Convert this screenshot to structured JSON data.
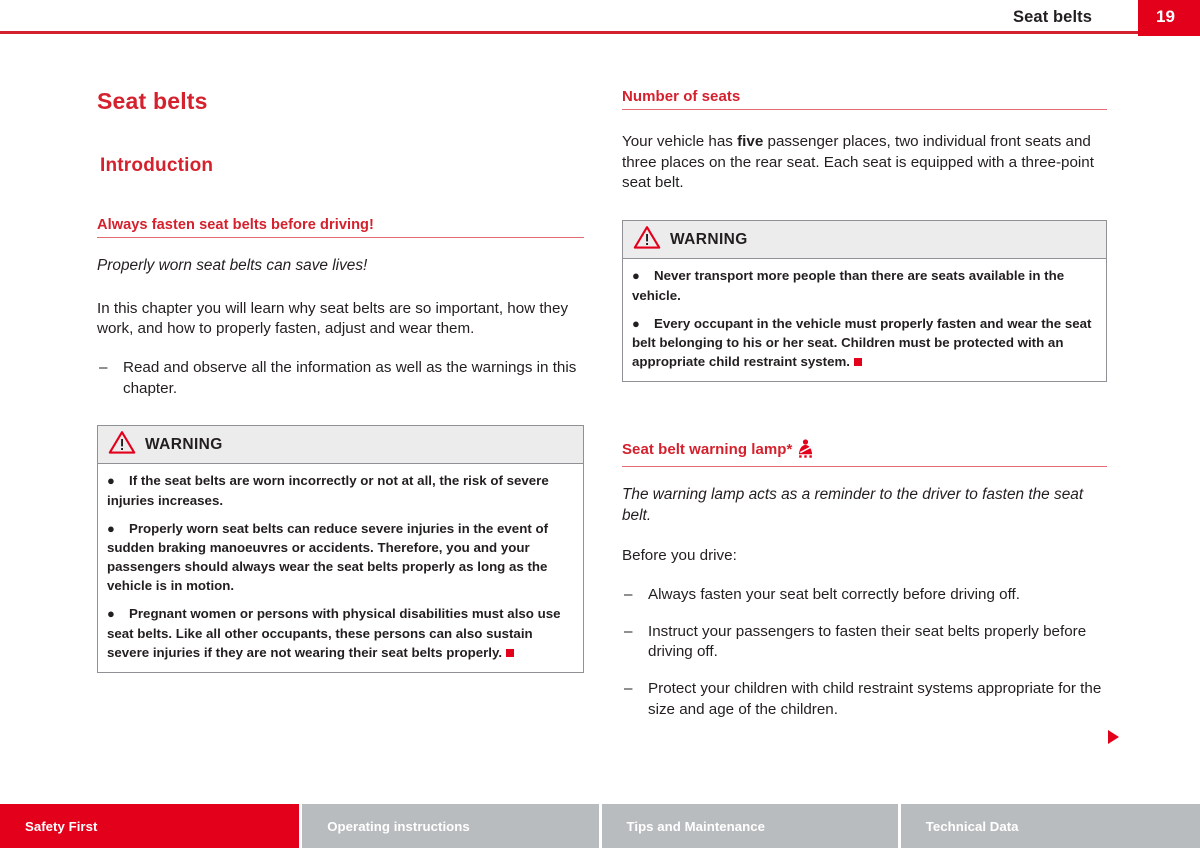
{
  "header": {
    "title": "Seat belts",
    "page_number": "19"
  },
  "chapter": {
    "title": "Seat belts",
    "section_title": "Introduction"
  },
  "left": {
    "sub_head": "Always fasten seat belts before driving!",
    "lead": "Properly worn seat belts can save lives!",
    "body": "In this chapter you will learn why seat belts are so important, how they work, and how to properly fasten, adjust and wear them.",
    "list": [
      "Read and observe all the information as well as the warnings in this chapter."
    ],
    "warning": {
      "label": "WARNING",
      "items": [
        "If the seat belts are worn incorrectly or not at all, the risk of severe injuries increases.",
        "Properly worn seat belts can reduce severe injuries in the event of sudden braking manoeuvres or accidents. Therefore, you and your passengers should always wear the seat belts properly as long as the vehicle is in motion.",
        "Pregnant women or persons with physical disabilities must also use seat belts. Like all other occupants, these persons can also sustain severe injuries if they are not wearing their seat belts properly."
      ]
    }
  },
  "right": {
    "sub_head": "Number of seats",
    "body_pre": "Your vehicle has ",
    "body_bold": "five",
    "body_post": " passenger places, two individual front seats and three places on the rear seat. Each seat is equipped with a three-point seat belt.",
    "warning": {
      "label": "WARNING",
      "items": [
        "Never transport more people than there are seats available in the vehicle.",
        "Every occupant in the vehicle must properly fasten and wear the seat belt belonging to his or her seat. Children must be protected with an appropriate child restraint system."
      ]
    },
    "lamp_head": "Seat belt warning lamp*",
    "lamp_lead": "The warning lamp acts as a reminder to the driver to fasten the seat belt.",
    "lamp_body": "Before you drive:",
    "lamp_list": [
      "Always fasten your seat belt correctly before driving off.",
      "Instruct your passengers to fasten their seat belts properly before driving off.",
      "Protect your children with child restraint systems appropriate for the size and age of the children."
    ]
  },
  "footer": {
    "tabs": [
      {
        "label": "Safety First",
        "active": true
      },
      {
        "label": "Operating instructions",
        "active": false
      },
      {
        "label": "Tips and Maintenance",
        "active": false
      },
      {
        "label": "Technical Data",
        "active": false
      }
    ]
  },
  "colors": {
    "brand_red": "#e3001b",
    "heading_red": "#d5212d",
    "rule_red": "#e26a72",
    "gray_tab": "#b9bcbe",
    "warning_head_bg": "#ececec",
    "warning_border": "#8f9195",
    "text": "#231f20"
  }
}
